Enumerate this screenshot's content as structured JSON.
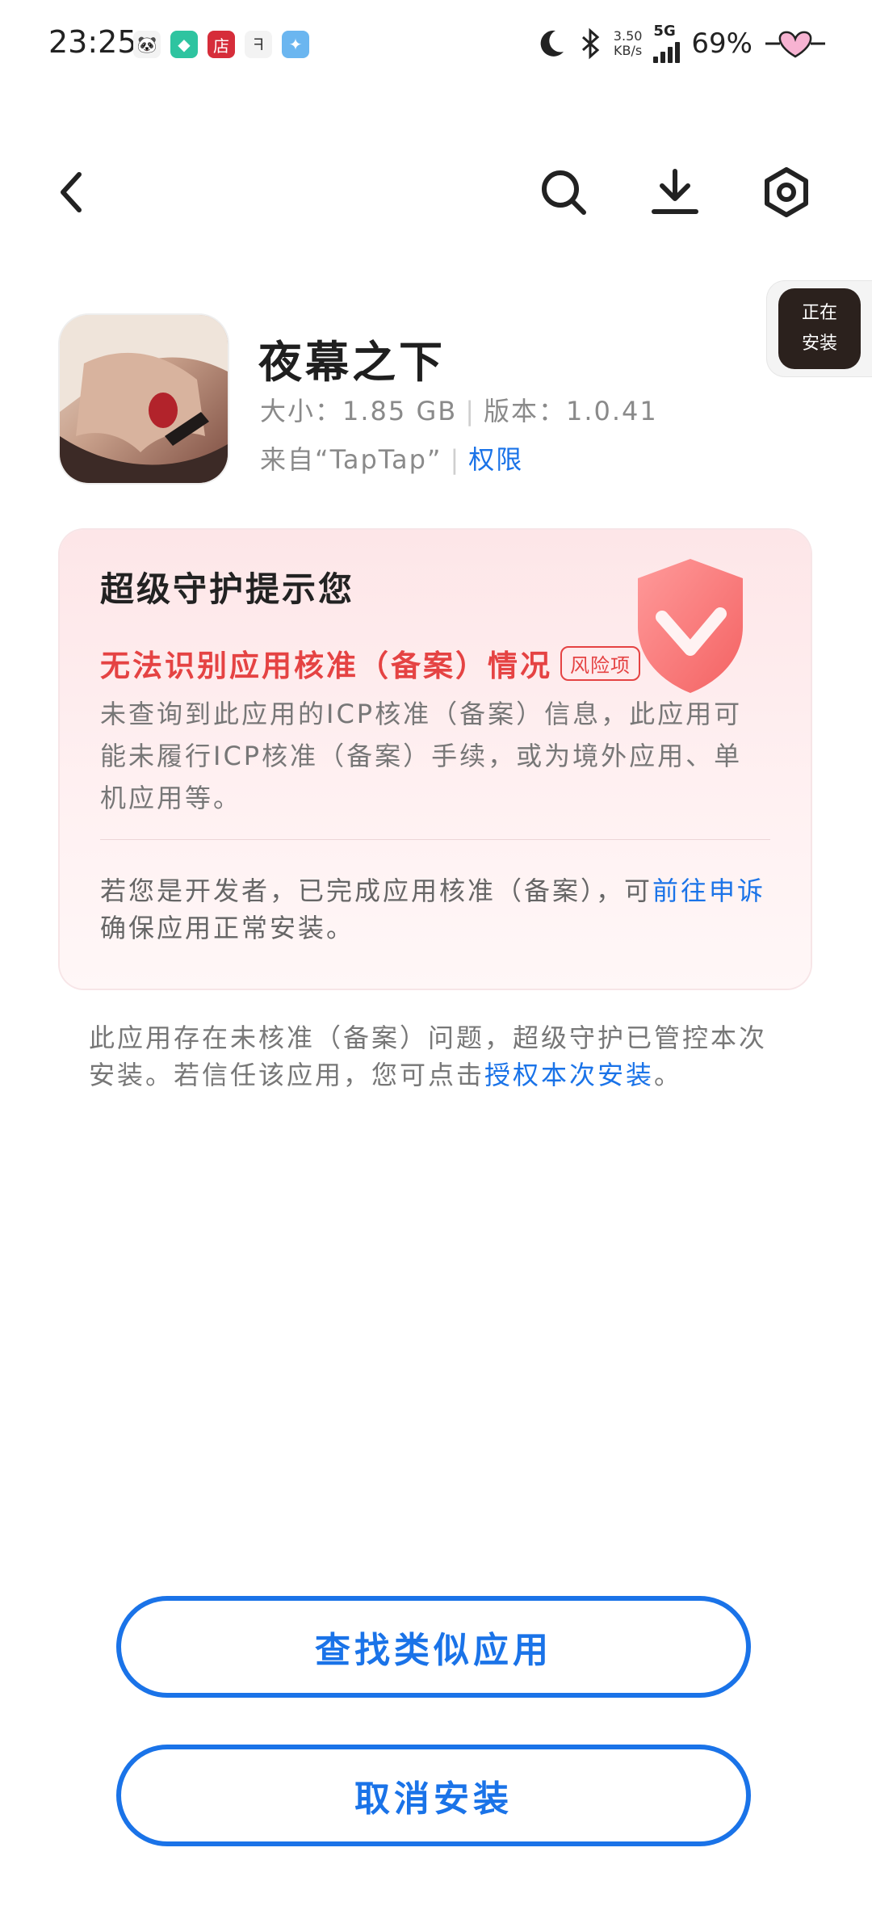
{
  "status_bar": {
    "time": "23:25",
    "notification_icons": [
      "panda-app-icon",
      "shield-app-icon",
      "store-app-icon",
      "link-app-icon",
      "game-app-icon"
    ],
    "speed_value": "3.50",
    "speed_unit": "KB/s",
    "network": "5G",
    "battery": "69%"
  },
  "toolbar": {
    "back_icon": "chevron-left-icon",
    "search_icon": "search-icon",
    "download_icon": "download-icon",
    "settings_icon": "settings-icon"
  },
  "installing_badge": {
    "line1": "正在",
    "line2": "安装"
  },
  "app": {
    "name": "夜幕之下",
    "size_label": "大小：",
    "size": "1.85 GB",
    "version_label": "版本：",
    "version": "1.0.41",
    "source": "来自“TapTap”",
    "permissions": "权限"
  },
  "warning_card": {
    "title": "超级守护提示您",
    "risk_title": "无法识别应用核准（备案）情况",
    "risk_tag": "风险项",
    "description": "未查询到此应用的ICP核准（备案）信息，此应用可能未履行ICP核准（备案）手续，或为境外应用、单机应用等。",
    "developer_text_prefix": "若您是开发者，已完成应用核准（备案），可",
    "developer_link": "前往申诉",
    "developer_text_suffix": "确保应用正常安装。"
  },
  "notice": {
    "text_prefix": "此应用存在未核准（备案）问题，超级守护已管控本次安装。若信任该应用，您可点击",
    "link": "授权本次安装",
    "text_suffix": "。"
  },
  "buttons": {
    "find_similar": "查找类似应用",
    "cancel_install": "取消安装"
  },
  "colors": {
    "accent": "#1a73e8",
    "risk": "#e54343",
    "card_bg": "#fde6e8"
  }
}
